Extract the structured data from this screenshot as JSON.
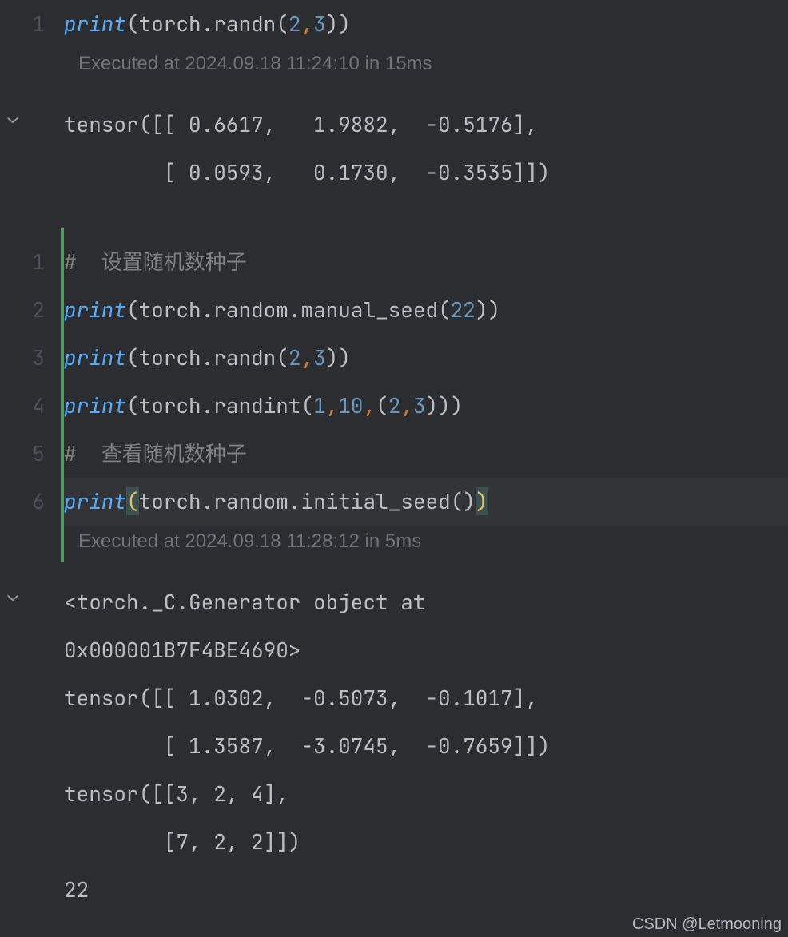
{
  "cell1": {
    "lines": [
      {
        "n": "1",
        "tokens": [
          {
            "t": "print",
            "c": "tok-fn"
          },
          {
            "t": "(",
            "c": "tok-par"
          },
          {
            "t": "torch",
            "c": "tok-id"
          },
          {
            "t": ".",
            "c": "tok-dot"
          },
          {
            "t": "randn",
            "c": "tok-id"
          },
          {
            "t": "(",
            "c": "tok-par"
          },
          {
            "t": "2",
            "c": "tok-num"
          },
          {
            "t": ",",
            "c": "tok-comma"
          },
          {
            "t": "3",
            "c": "tok-num"
          },
          {
            "t": ")",
            "c": "tok-par"
          },
          {
            "t": ")",
            "c": "tok-par"
          }
        ]
      }
    ],
    "exec": "Executed at 2024.09.18 11:24:10 in 15ms",
    "output": "tensor([[ 0.6617,   1.9882,  -0.5176],\n        [ 0.0593,   0.1730,  -0.3535]])"
  },
  "cell2": {
    "lines": [
      {
        "n": "1",
        "tokens": [
          {
            "t": "#  设置随机数种子",
            "c": "tok-comment"
          }
        ]
      },
      {
        "n": "2",
        "tokens": [
          {
            "t": "print",
            "c": "tok-fn"
          },
          {
            "t": "(",
            "c": "tok-par"
          },
          {
            "t": "torch",
            "c": "tok-id"
          },
          {
            "t": ".",
            "c": "tok-dot"
          },
          {
            "t": "random",
            "c": "tok-id"
          },
          {
            "t": ".",
            "c": "tok-dot"
          },
          {
            "t": "manual_seed",
            "c": "tok-id"
          },
          {
            "t": "(",
            "c": "tok-par"
          },
          {
            "t": "22",
            "c": "tok-num"
          },
          {
            "t": ")",
            "c": "tok-par"
          },
          {
            "t": ")",
            "c": "tok-par"
          }
        ]
      },
      {
        "n": "3",
        "tokens": [
          {
            "t": "print",
            "c": "tok-fn"
          },
          {
            "t": "(",
            "c": "tok-par"
          },
          {
            "t": "torch",
            "c": "tok-id"
          },
          {
            "t": ".",
            "c": "tok-dot"
          },
          {
            "t": "randn",
            "c": "tok-id"
          },
          {
            "t": "(",
            "c": "tok-par"
          },
          {
            "t": "2",
            "c": "tok-num"
          },
          {
            "t": ",",
            "c": "tok-comma"
          },
          {
            "t": "3",
            "c": "tok-num"
          },
          {
            "t": ")",
            "c": "tok-par"
          },
          {
            "t": ")",
            "c": "tok-par"
          }
        ]
      },
      {
        "n": "4",
        "tokens": [
          {
            "t": "print",
            "c": "tok-fn"
          },
          {
            "t": "(",
            "c": "tok-par"
          },
          {
            "t": "torch",
            "c": "tok-id"
          },
          {
            "t": ".",
            "c": "tok-dot"
          },
          {
            "t": "randint",
            "c": "tok-id"
          },
          {
            "t": "(",
            "c": "tok-par"
          },
          {
            "t": "1",
            "c": "tok-num"
          },
          {
            "t": ",",
            "c": "tok-comma"
          },
          {
            "t": "10",
            "c": "tok-num"
          },
          {
            "t": ",",
            "c": "tok-comma"
          },
          {
            "t": "(",
            "c": "tok-par"
          },
          {
            "t": "2",
            "c": "tok-num"
          },
          {
            "t": ",",
            "c": "tok-comma"
          },
          {
            "t": "3",
            "c": "tok-num"
          },
          {
            "t": ")",
            "c": "tok-par"
          },
          {
            "t": ")",
            "c": "tok-par"
          },
          {
            "t": ")",
            "c": "tok-par"
          }
        ]
      },
      {
        "n": "5",
        "tokens": [
          {
            "t": "#  查看随机数种子",
            "c": "tok-comment"
          }
        ]
      },
      {
        "n": "6",
        "hl": true,
        "tokens": [
          {
            "t": "print",
            "c": "tok-fn"
          },
          {
            "t": "(",
            "c": "tok-ypar",
            "pm": true
          },
          {
            "t": "torch",
            "c": "tok-id"
          },
          {
            "t": ".",
            "c": "tok-dot"
          },
          {
            "t": "random",
            "c": "tok-id"
          },
          {
            "t": ".",
            "c": "tok-dot"
          },
          {
            "t": "initial_seed",
            "c": "tok-id"
          },
          {
            "t": "(",
            "c": "tok-par"
          },
          {
            "t": ")",
            "c": "tok-par"
          },
          {
            "t": ")",
            "c": "tok-ypar",
            "pm": true
          }
        ]
      }
    ],
    "exec": "Executed at 2024.09.18 11:28:12 in 5ms",
    "output": "<torch._C.Generator object at \n0x000001B7F4BE4690>\ntensor([[ 1.0302,  -0.5073,  -0.1017],\n        [ 1.3587,  -3.0745,  -0.7659]])\ntensor([[3, 2, 4],\n        [7, 2, 2]])\n22"
  },
  "chevron": "⌄",
  "watermark": "CSDN @Letmooning"
}
